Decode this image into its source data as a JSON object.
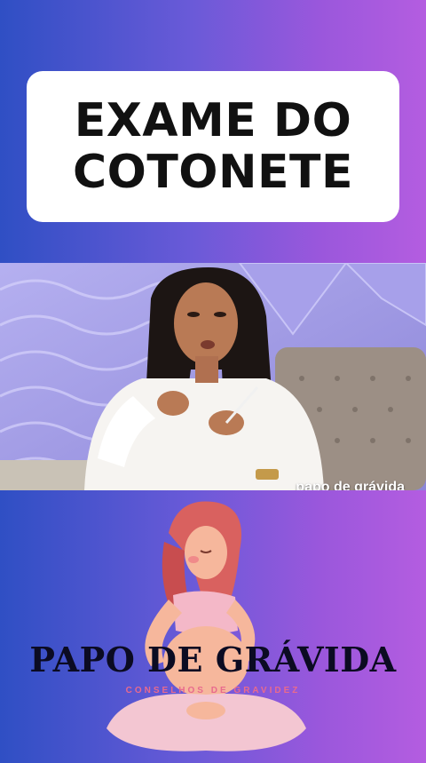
{
  "title": {
    "line1": "EXAME DO",
    "line2": "COTONETE"
  },
  "video": {
    "caption": "papo de grávida"
  },
  "logo": {
    "title": "PAPO DE GRÁVIDA",
    "subtitle": "CONSELHOS DE GRAVIDEZ"
  },
  "colors": {
    "gradient_left": "#2f4fc4",
    "gradient_right": "#b45de0",
    "title_card": "#ffffff",
    "logo_text": "#0b0b22",
    "logo_subtitle": "#e86a8e"
  }
}
